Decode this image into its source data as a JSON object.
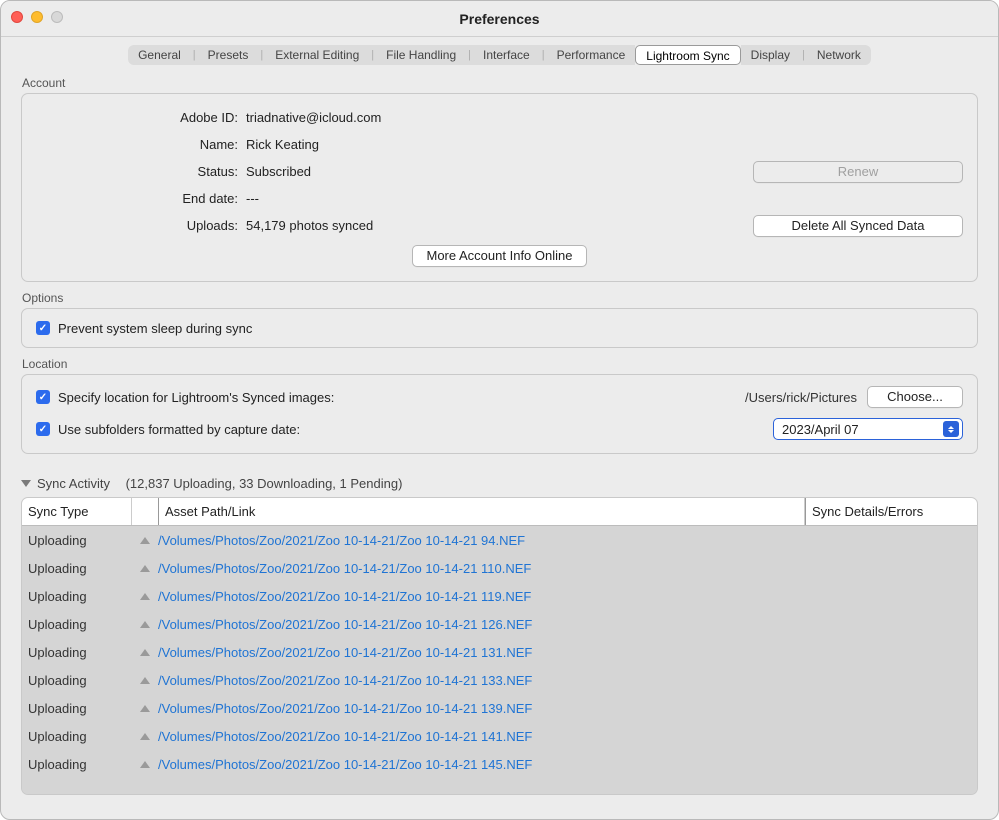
{
  "window": {
    "title": "Preferences"
  },
  "tabs": {
    "items": [
      "General",
      "Presets",
      "External Editing",
      "File Handling",
      "Interface",
      "Performance",
      "Lightroom Sync",
      "Display",
      "Network"
    ],
    "active_index": 6
  },
  "account": {
    "legend": "Account",
    "labels": {
      "adobe_id": "Adobe ID:",
      "name": "Name:",
      "status": "Status:",
      "end_date": "End date:",
      "uploads": "Uploads:"
    },
    "values": {
      "adobe_id": "triadnative@icloud.com",
      "name": "Rick Keating",
      "status": "Subscribed",
      "end_date": "---",
      "uploads": "54,179 photos synced"
    },
    "buttons": {
      "renew": "Renew",
      "delete_all": "Delete All Synced Data",
      "more_info": "More Account Info Online"
    }
  },
  "options": {
    "legend": "Options",
    "prevent_sleep_label": "Prevent system sleep during sync",
    "prevent_sleep_checked": true
  },
  "location": {
    "legend": "Location",
    "specify_label": "Specify location for Lightroom's Synced images:",
    "specify_checked": true,
    "path": "/Users/rick/Pictures",
    "choose_label": "Choose...",
    "subfolders_label": "Use subfolders formatted by capture date:",
    "subfolders_checked": true,
    "date_format": "2023/April 07"
  },
  "sync": {
    "header_label": "Sync Activity",
    "header_suffix": "(12,837 Uploading, 33 Downloading, 1 Pending)",
    "columns": {
      "type": "Sync Type",
      "path": "Asset Path/Link",
      "details": "Sync Details/Errors"
    },
    "rows": [
      {
        "type": "Uploading",
        "path": "/Volumes/Photos/Zoo/2021/Zoo 10-14-21/Zoo 10-14-21 94.NEF"
      },
      {
        "type": "Uploading",
        "path": "/Volumes/Photos/Zoo/2021/Zoo 10-14-21/Zoo 10-14-21 110.NEF"
      },
      {
        "type": "Uploading",
        "path": "/Volumes/Photos/Zoo/2021/Zoo 10-14-21/Zoo 10-14-21 119.NEF"
      },
      {
        "type": "Uploading",
        "path": "/Volumes/Photos/Zoo/2021/Zoo 10-14-21/Zoo 10-14-21 126.NEF"
      },
      {
        "type": "Uploading",
        "path": "/Volumes/Photos/Zoo/2021/Zoo 10-14-21/Zoo 10-14-21 131.NEF"
      },
      {
        "type": "Uploading",
        "path": "/Volumes/Photos/Zoo/2021/Zoo 10-14-21/Zoo 10-14-21 133.NEF"
      },
      {
        "type": "Uploading",
        "path": "/Volumes/Photos/Zoo/2021/Zoo 10-14-21/Zoo 10-14-21 139.NEF"
      },
      {
        "type": "Uploading",
        "path": "/Volumes/Photos/Zoo/2021/Zoo 10-14-21/Zoo 10-14-21 141.NEF"
      },
      {
        "type": "Uploading",
        "path": "/Volumes/Photos/Zoo/2021/Zoo 10-14-21/Zoo 10-14-21 145.NEF"
      }
    ]
  }
}
